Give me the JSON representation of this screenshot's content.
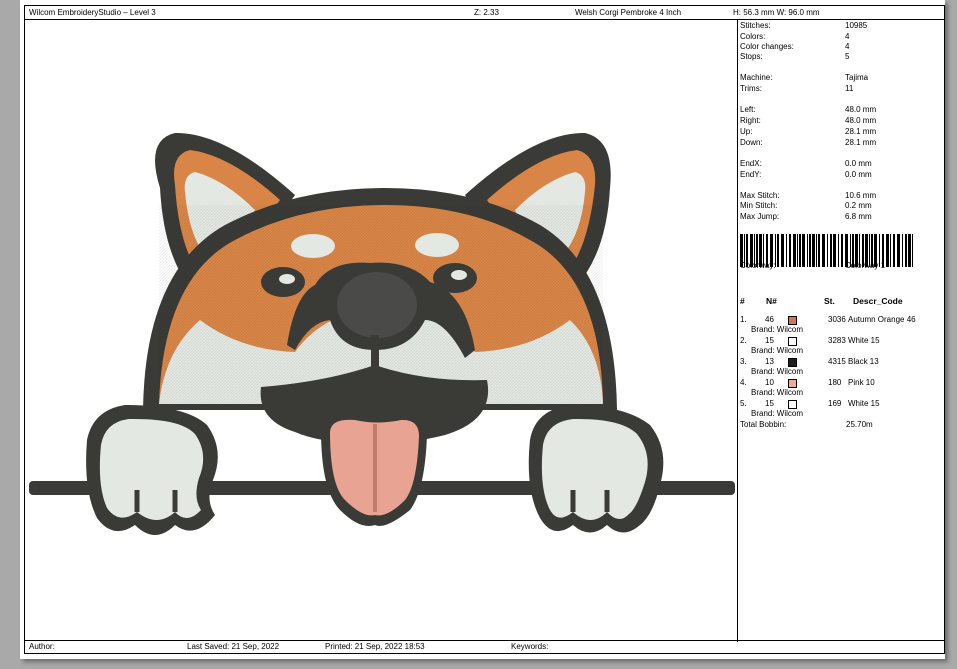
{
  "header": {
    "app": "Wilcom EmbroideryStudio – Level 3",
    "zoom": "Z: 2.33",
    "design": "Welsh Corgi Pembroke 4 Inch",
    "size": "H: 56.3 mm   W: 96.0 mm"
  },
  "stats": [
    {
      "k": "Stitches:",
      "v": "10985"
    },
    {
      "k": "Colors:",
      "v": "4"
    },
    {
      "k": "Color changes:",
      "v": "4"
    },
    {
      "k": "Stops:",
      "v": "5"
    },
    {
      "k": "Machine:",
      "v": "Tajima"
    },
    {
      "k": "Trims:",
      "v": "11"
    },
    {
      "k": "Left:",
      "v": "48.0 mm"
    },
    {
      "k": "Right:",
      "v": "48.0 mm"
    },
    {
      "k": "Up:",
      "v": "28.1 mm"
    },
    {
      "k": "Down:",
      "v": "28.1 mm"
    },
    {
      "k": "EndX:",
      "v": "0.0 mm"
    },
    {
      "k": "EndY:",
      "v": "0.0 mm"
    },
    {
      "k": "Max Stitch:",
      "v": "10.6 mm"
    },
    {
      "k": "Min Stitch:",
      "v": "0.2 mm"
    },
    {
      "k": "Max Jump:",
      "v": "6.8 mm"
    },
    {
      "k": "Colorway:",
      "v": "Colorway 1"
    }
  ],
  "table": {
    "headers": [
      "#",
      "N#",
      "St.",
      "Descr_Code"
    ],
    "rows": [
      {
        "idx": "1.",
        "num": "46",
        "color": "#d2774a",
        "st": "3036",
        "desc": "Autumn Orange 46",
        "brand": "Brand: Wilcom"
      },
      {
        "idx": "2.",
        "num": "15",
        "color": "#ffffff",
        "st": "3283",
        "desc": "White 15",
        "brand": "Brand: Wilcom"
      },
      {
        "idx": "3.",
        "num": "13",
        "color": "#1e1e1e",
        "st": "4315",
        "desc": "Black 13",
        "brand": "Brand: Wilcom"
      },
      {
        "idx": "4.",
        "num": "10",
        "color": "#f2a99a",
        "st": "180",
        "desc": "Pink 10",
        "brand": "Brand: Wilcom"
      },
      {
        "idx": "5.",
        "num": "15",
        "color": "#ffffff",
        "st": "169",
        "desc": "White 15",
        "brand": "Brand: Wilcom"
      }
    ],
    "total_label": "Total Bobbin:",
    "total_value": "25.70m"
  },
  "footer": {
    "author": "Author:",
    "saved": "Last Saved: 21 Sep, 2022",
    "printed": "Printed: 21 Sep, 2022 18:53",
    "keywords": "Keywords:"
  },
  "colors": {
    "outline": "#3a3a37",
    "orange": "#d98547",
    "cream": "#e4e8e2",
    "nose": "#4a4a48",
    "tongue": "#e9a392"
  }
}
